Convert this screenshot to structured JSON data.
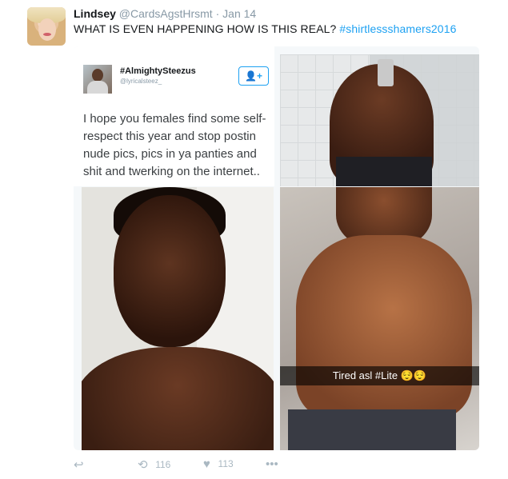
{
  "tweet": {
    "author": {
      "display_name": "Lindsey",
      "handle": "@CardsAgstHrsmt",
      "separator": "·",
      "time": "Jan 14"
    },
    "text_main": "WHAT IS EVEN HAPPENING HOW IS THIS REAL?",
    "hashtag": "#shirtlessshamers2016",
    "media": {
      "embedded_tweet": {
        "name": "#AlmightySteezus",
        "handle": "@lyricalsteez_",
        "follow_icon": "follow-user-icon",
        "follow_glyph": "👤+",
        "text": "I hope you females find some self-respect this year and stop postin nude pics, pics in ya panties and shit and twerking on the internet.."
      },
      "photo_caption": "Tired asl #Lite 😌😌"
    },
    "actions": {
      "reply_icon": "↩",
      "retweet_icon": "⟲",
      "retweet_count": "116",
      "like_icon": "♥",
      "like_count": "113",
      "more_icon": "•••"
    }
  },
  "colors": {
    "link_blue": "#1da1f2",
    "muted_gray": "#8899a6",
    "action_gray": "#aab8c2"
  }
}
